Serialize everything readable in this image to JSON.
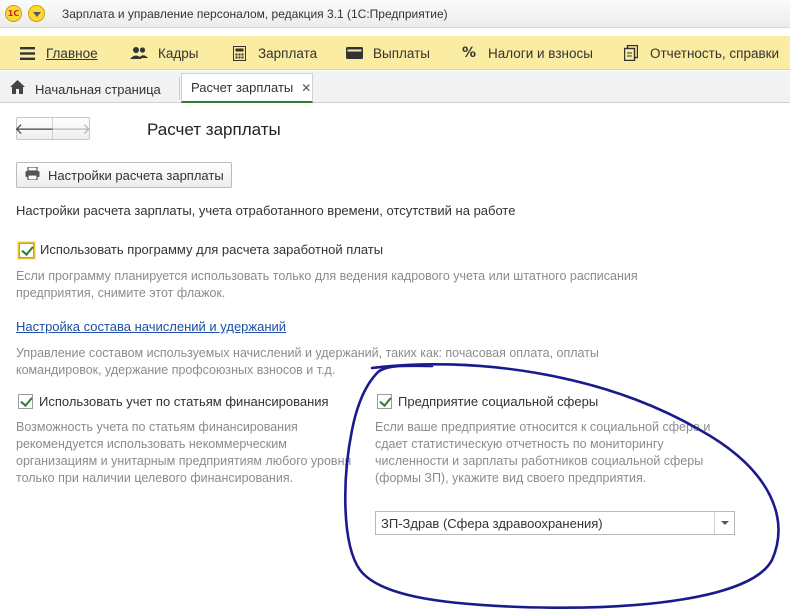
{
  "window": {
    "app_logo": "1С",
    "title": "Зарплата и управление персоналом, редакция 3.1  (1С:Предприятие)"
  },
  "sections": [
    {
      "label": "Главное",
      "icon": "hamburger-icon",
      "active": true
    },
    {
      "label": "Кадры",
      "icon": "users-icon"
    },
    {
      "label": "Зарплата",
      "icon": "calculator-icon"
    },
    {
      "label": "Выплаты",
      "icon": "wallet-icon"
    },
    {
      "label": "Налоги и взносы",
      "icon": "percent-icon"
    },
    {
      "label": "Отчетность, справки",
      "icon": "documents-icon"
    }
  ],
  "tabs": {
    "home": "Начальная страница",
    "active": "Расчет зарплаты"
  },
  "form": {
    "title": "Расчет зарплаты",
    "settings_button": "Настройки расчета зарплаты",
    "group_label": "Настройки расчета зарплаты, учета отработанного времени, отсутствий на работе",
    "use_program": {
      "label": "Использовать программу для расчета заработной платы",
      "checked": true,
      "hint_lines": [
        "Если программу планируется использовать только для ведения кадрового учета или штатного расписания",
        "предприятия, снимите этот флажок."
      ]
    },
    "accruals_link": {
      "label": "Настройка состава начислений и удержаний",
      "hint_lines": [
        "Управление составом используемых начислений и удержаний, таких как: почасовая оплата, оплаты",
        "командировок, удержание профсоюзных взносов и т.д."
      ]
    },
    "financing": {
      "label": "Использовать учет по статьям финансирования",
      "checked": true,
      "hint_lines": [
        "Возможность учета по статьям финансирования",
        "рекомендуется использовать некоммерческим",
        "организациям и унитарным предприятиям любого уровня",
        "только при наличии целевого финансирования."
      ]
    },
    "social_sphere": {
      "label": "Предприятие социальной сферы",
      "checked": true,
      "hint_lines": [
        "Если ваше предприятие относится к социальной сфере и",
        "сдает статистическую отчетность по мониторингу",
        "численности и зарплаты работников социальной сферы",
        "(формы ЗП), укажите вид своего предприятия."
      ],
      "select_value": "ЗП-Здрав (Сфера здравоохранения)"
    }
  },
  "colors": {
    "section_bar": "#fbeca3",
    "check": "#2e7d32",
    "link": "#1c4fa5",
    "hint_text": "#8c8c8c",
    "annotation_ink": "#1a1a8c"
  }
}
